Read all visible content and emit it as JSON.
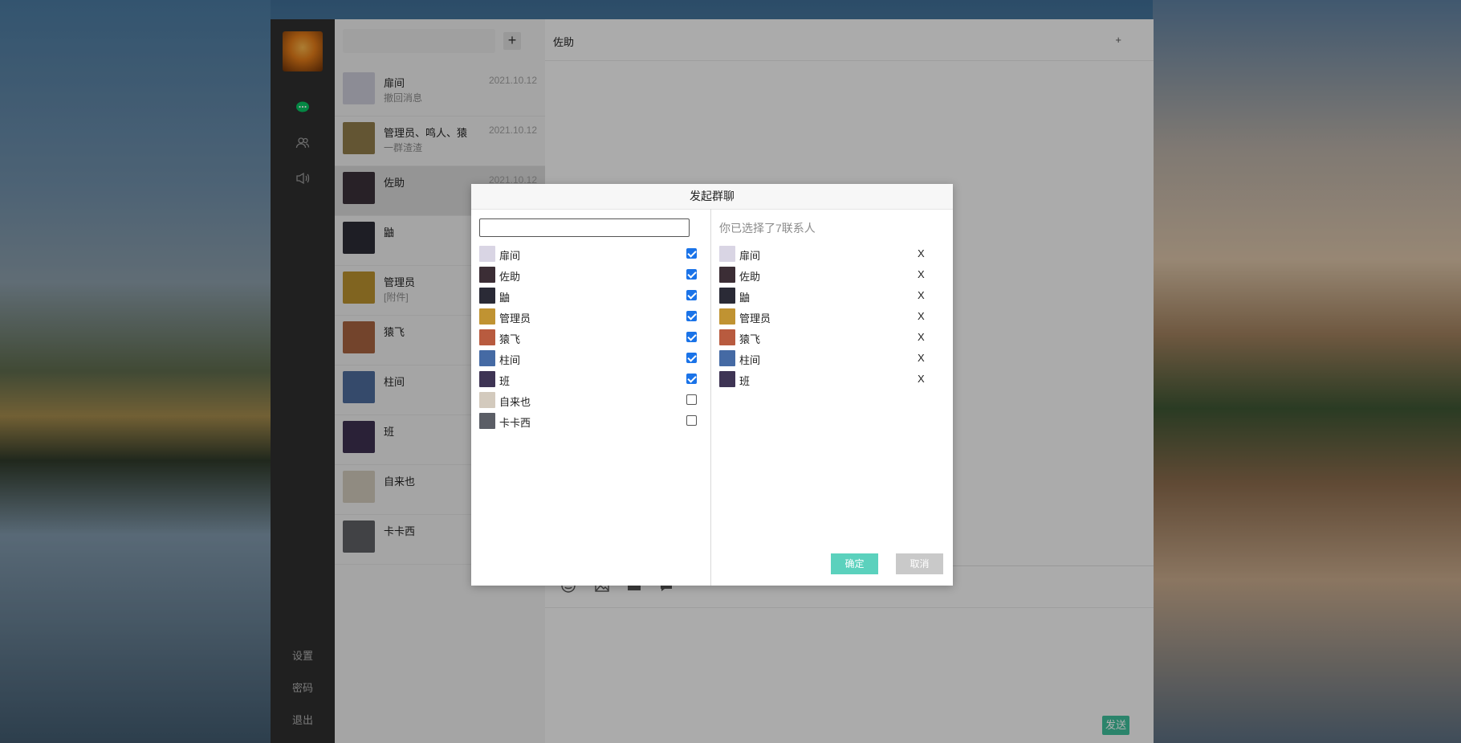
{
  "app": {
    "nav": {
      "bottom": [
        "设置",
        "密码",
        "退出"
      ]
    },
    "conversations": [
      {
        "name": "扉间",
        "msg": "撤回消息",
        "time": "2021.10.12",
        "color": "#c9c9d6"
      },
      {
        "name": "管理员、鸣人、猿",
        "msg": "一群渣渣",
        "time": "2021.10.12",
        "color": "#8e7a4a"
      },
      {
        "name": "佐助",
        "msg": "",
        "time": "2021.10.12",
        "color": "#3a3038"
      },
      {
        "name": "鼬",
        "msg": "",
        "time": "",
        "color": "#2b2b35"
      },
      {
        "name": "管理员",
        "msg": "[附件]",
        "time": "",
        "color": "#b8902f"
      },
      {
        "name": "猿飞",
        "msg": "",
        "time": "",
        "color": "#a5623f"
      },
      {
        "name": "柱间",
        "msg": "",
        "time": "",
        "color": "#4d6a9a"
      },
      {
        "name": "班",
        "msg": "",
        "time": "",
        "color": "#3d3050"
      },
      {
        "name": "自来也",
        "msg": "",
        "time": "",
        "color": "#cfc7b9"
      },
      {
        "name": "卡卡西",
        "msg": "",
        "time": "",
        "color": "#5d5f64"
      }
    ],
    "chat": {
      "title": "佐助",
      "plus": "+",
      "send": "发送"
    }
  },
  "modal": {
    "title": "发起群聊",
    "search_value": "",
    "summary": "你已选择了7联系人",
    "confirm": "确定",
    "cancel": "取消",
    "contacts": [
      {
        "name": "扉间",
        "checked": true,
        "color": "#d9d5e4"
      },
      {
        "name": "佐助",
        "checked": true,
        "color": "#3b2d35"
      },
      {
        "name": "鼬",
        "checked": true,
        "color": "#2a2a36"
      },
      {
        "name": "管理员",
        "checked": true,
        "color": "#c09332"
      },
      {
        "name": "猿飞",
        "checked": true,
        "color": "#b85b3f"
      },
      {
        "name": "柱间",
        "checked": true,
        "color": "#456aa4"
      },
      {
        "name": "班",
        "checked": true,
        "color": "#3e3454"
      },
      {
        "name": "自来也",
        "checked": false,
        "color": "#d3cabd"
      },
      {
        "name": "卡卡西",
        "checked": false,
        "color": "#5b5e66"
      }
    ],
    "selected": [
      {
        "name": "扉间",
        "remove": "X",
        "color": "#d9d5e4"
      },
      {
        "name": "佐助",
        "remove": "X",
        "color": "#3b2d35"
      },
      {
        "name": "鼬",
        "remove": "X",
        "color": "#2a2a36"
      },
      {
        "name": "管理员",
        "remove": "X",
        "color": "#c09332"
      },
      {
        "name": "猿飞",
        "remove": "X",
        "color": "#b85b3f"
      },
      {
        "name": "柱间",
        "remove": "X",
        "color": "#456aa4"
      },
      {
        "name": "班",
        "remove": "X",
        "color": "#3e3454"
      }
    ]
  }
}
